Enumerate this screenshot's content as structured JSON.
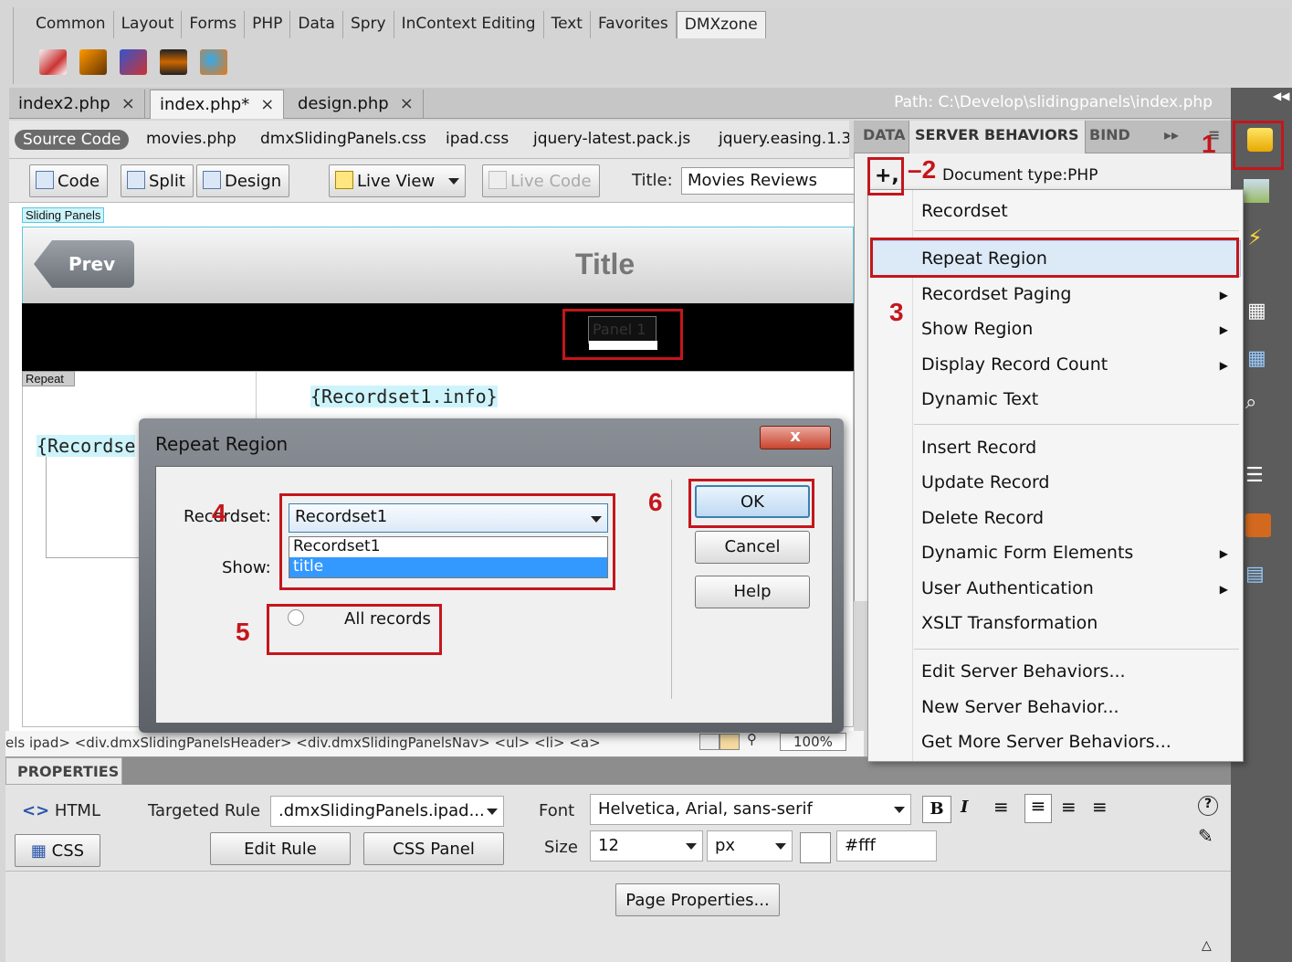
{
  "insert_bar": {
    "tabs": [
      "Common",
      "Layout",
      "Forms",
      "PHP",
      "Data",
      "Spry",
      "InContext Editing",
      "Text",
      "Favorites",
      "DMXzone"
    ],
    "active_tab": "DMXzone"
  },
  "doc_tabs": {
    "files": [
      {
        "name": "index2.php",
        "close": "×"
      },
      {
        "name": "index.php*",
        "close": "×"
      },
      {
        "name": "design.php",
        "close": "×"
      }
    ],
    "path": "Path:  C:\\Develop\\slidingpanels\\index.php"
  },
  "related_files": {
    "source": "Source Code",
    "files": [
      "movies.php",
      "dmxSlidingPanels.css",
      "ipad.css",
      "jquery-latest.pack.js",
      "jquery.easing.1.3"
    ]
  },
  "toolbar": {
    "code": "Code",
    "split": "Split",
    "design": "Design",
    "live_view": "Live View",
    "live_code": "Live Code",
    "title_label": "Title:",
    "title_value": "Movies Reviews"
  },
  "design_view": {
    "sliding_label": "Sliding Panels",
    "prev": "Prev",
    "title": "Title",
    "panel": "Panel 1",
    "repeat_label": "Repeat",
    "info_field": "{Recordset1.info}",
    "left_field": "{Recordse"
  },
  "tag_selector": "els ipad> <div.dmxSlidingPanelsHeader> <div.dmxSlidingPanelsNav> <ul> <li> <a>",
  "zoom": "100%",
  "properties": {
    "header": "PROPERTIES",
    "html": "HTML",
    "css": "CSS",
    "targeted_rule_label": "Targeted Rule",
    "targeted_rule_value": ".dmxSlidingPanels.ipad...",
    "edit_rule": "Edit Rule",
    "css_panel": "CSS Panel",
    "font_label": "Font",
    "font_value": "Helvetica, Arial, sans-serif",
    "size_label": "Size",
    "size_value": "12",
    "size_unit": "px",
    "color_value": "#fff",
    "page_properties": "Page Properties..."
  },
  "panel": {
    "tabs": [
      "DATA",
      "SERVER BEHAVIORS",
      "BIND"
    ],
    "plus": "+,",
    "doctype": "Document type:PHP"
  },
  "menu": {
    "items": [
      {
        "label": "Recordset",
        "sub": false
      },
      {
        "label": "Repeat Region",
        "sub": false
      },
      {
        "label": "Recordset Paging",
        "sub": true
      },
      {
        "label": "Show Region",
        "sub": true
      },
      {
        "label": "Display Record Count",
        "sub": true
      },
      {
        "label": "Dynamic Text",
        "sub": false
      },
      {
        "label": "Insert Record",
        "sub": false
      },
      {
        "label": "Update Record",
        "sub": false
      },
      {
        "label": "Delete Record",
        "sub": false
      },
      {
        "label": "Dynamic Form Elements",
        "sub": true
      },
      {
        "label": "User Authentication",
        "sub": true
      },
      {
        "label": "XSLT Transformation",
        "sub": false
      },
      {
        "label": "Edit Server Behaviors...",
        "sub": false
      },
      {
        "label": "New Server Behavior...",
        "sub": false
      },
      {
        "label": "Get More Server Behaviors...",
        "sub": false
      }
    ],
    "highlighted": "Repeat Region"
  },
  "dialog": {
    "title": "Repeat Region",
    "close": "x",
    "recordset_label": "Recordset:",
    "recordset_value": "Recordset1",
    "list_options": [
      "Recordset1",
      "title"
    ],
    "selected_option": "title",
    "show_label": "Show:",
    "all_records": "All records",
    "ok": "OK",
    "cancel": "Cancel",
    "help": "Help"
  },
  "annotations": [
    "1",
    "2",
    "3",
    "4",
    "5",
    "6"
  ],
  "colors": {
    "annotation": "#c4161c",
    "accent": "#3399ff",
    "cyan_field": "#cdf4fb"
  }
}
